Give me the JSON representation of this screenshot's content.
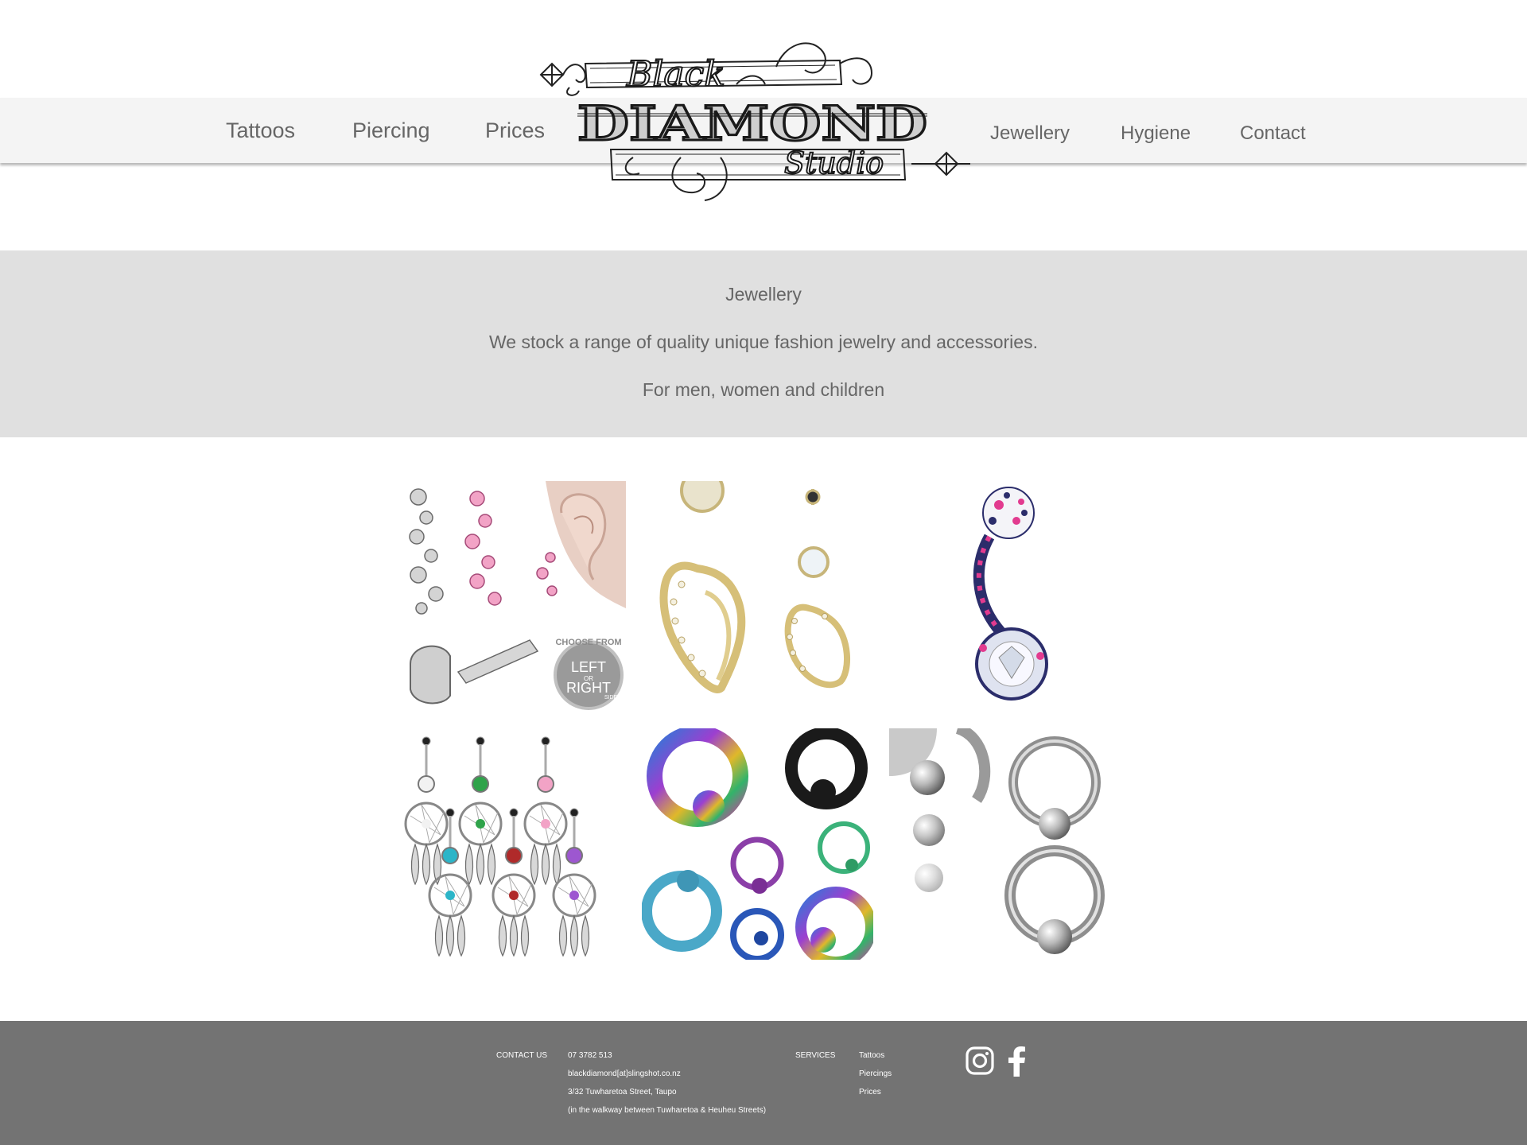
{
  "nav": {
    "left": [
      "Tattoos",
      "Piercing",
      "Prices"
    ],
    "right": [
      "Jewellery",
      "Hygiene",
      "Contact"
    ]
  },
  "logo": {
    "word1": "Black",
    "word2": "DIAMOND",
    "word3": "Studio"
  },
  "banner": {
    "title": "Jewellery",
    "line1": "We stock a range of quality unique fashion jewelry and accessories.",
    "line2": "For men, women and children"
  },
  "gallery": {
    "badge": {
      "top": "CHOOSE FROM",
      "left": "LEFT",
      "or": "OR",
      "right": "RIGHT",
      "side": "SIDE"
    }
  },
  "footer": {
    "contact_heading": "CONTACT US",
    "phone": "07 3782 513",
    "email": "blackdiamond[at]slingshot.co.nz",
    "address": "3/32 Tuwharetoa Street, Taupo",
    "walkway": "(in the walkway between Tuwharetoa & Heuheu Streets)",
    "services_heading": "SERVICES",
    "services": [
      "Tattoos",
      "Piercings",
      "Prices"
    ]
  },
  "social": {
    "instagram": "instagram-icon",
    "facebook": "facebook-icon"
  },
  "colors": {
    "nav_bg": "#f4f4f4",
    "banner_bg": "#e0e0e0",
    "footer_bg": "#737373",
    "text": "#666666"
  }
}
